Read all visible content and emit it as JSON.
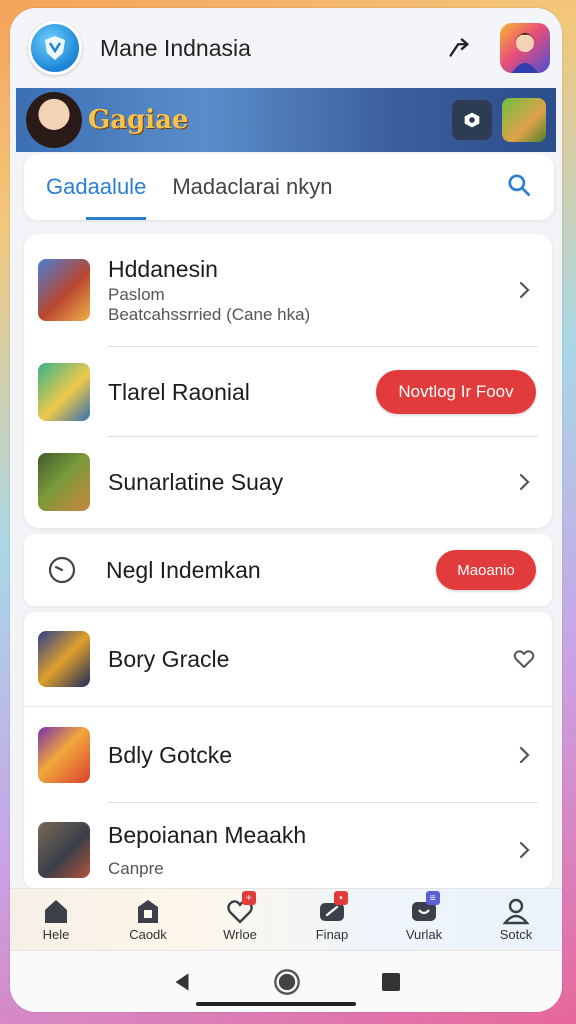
{
  "header": {
    "title": "Mane Indnasia",
    "logo_icon": "shield-logo-icon",
    "share_icon": "share-icon",
    "avatar_icon": "profile-avatar"
  },
  "banner": {
    "logo_text": "Gagiae"
  },
  "tabs": {
    "items": [
      {
        "label": "Gadaalule",
        "active": true
      },
      {
        "label": "Madaclarai nkyn",
        "active": false
      }
    ],
    "search_icon": "search-icon"
  },
  "featured_list": [
    {
      "title": "Hddanesin",
      "subtitle1": "Paslom",
      "subtitle2": "Beatcahssrried (Cane hka)",
      "action": "chevron"
    },
    {
      "title": "Tlarel Raonial",
      "action": "button",
      "button_label": "Novtlog Ir Foov"
    },
    {
      "title": "Sunarlatine Suay",
      "action": "chevron"
    }
  ],
  "section": {
    "title": "Negl Indemkan",
    "button_label": "Maoanio",
    "icon": "clock-icon"
  },
  "more_list": [
    {
      "title": "Bory Gracle",
      "action": "heart"
    },
    {
      "title": "Bdly Gotcke",
      "action": "chevron"
    },
    {
      "title": "Bepoianan Meaakh",
      "subtitle": "Canpre",
      "action": "chevron"
    }
  ],
  "bottom_nav": [
    {
      "label": "Hele",
      "icon": "home-icon"
    },
    {
      "label": "Caodk",
      "icon": "store-icon"
    },
    {
      "label": "Wrloe",
      "icon": "heart-icon",
      "badge": "+"
    },
    {
      "label": "Finap",
      "icon": "gamepad-icon",
      "badge": "•"
    },
    {
      "label": "Vurlak",
      "icon": "chat-icon",
      "badge": "≡"
    },
    {
      "label": "Sotck",
      "icon": "person-icon"
    }
  ],
  "colors": {
    "accent": "#2b7fd2",
    "button_red": "#e23b3b"
  }
}
